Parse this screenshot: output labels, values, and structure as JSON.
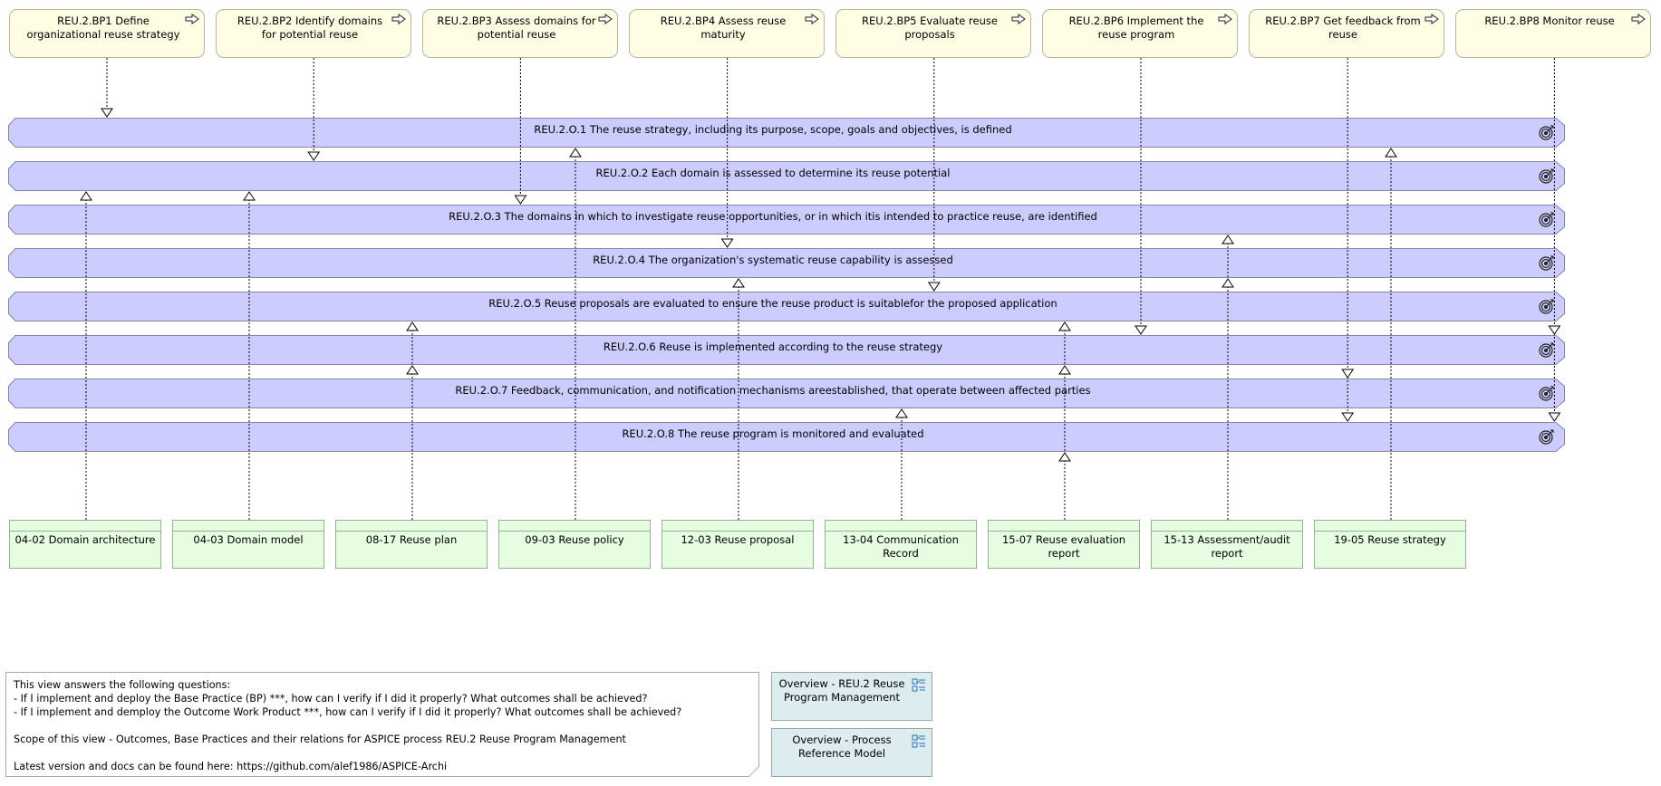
{
  "base_practices": [
    {
      "id": "BP1",
      "label": "REU.2.BP1 Define organizational reuse strategy"
    },
    {
      "id": "BP2",
      "label": "REU.2.BP2 Identify domains for potential reuse"
    },
    {
      "id": "BP3",
      "label": "REU.2.BP3 Assess domains for potential reuse"
    },
    {
      "id": "BP4",
      "label": "REU.2.BP4 Assess reuse maturity"
    },
    {
      "id": "BP5",
      "label": "REU.2.BP5 Evaluate reuse proposals"
    },
    {
      "id": "BP6",
      "label": "REU.2.BP6 Implement the reuse program"
    },
    {
      "id": "BP7",
      "label": "REU.2.BP7 Get feedback from reuse"
    },
    {
      "id": "BP8",
      "label": "REU.2.BP8 Monitor reuse"
    }
  ],
  "outcomes": [
    {
      "id": "O1",
      "label": "REU.2.O.1 The reuse strategy, including its purpose, scope, goals and objectives, is defined"
    },
    {
      "id": "O2",
      "label": "REU.2.O.2 Each domain is assessed to determine its reuse potential"
    },
    {
      "id": "O3",
      "label": "REU.2.O.3 The domains in which to investigate reuse opportunities, or in which itis intended to practice reuse, are identified"
    },
    {
      "id": "O4",
      "label": "REU.2.O.4 The organization's systematic reuse capability is assessed"
    },
    {
      "id": "O5",
      "label": "REU.2.O.5 Reuse proposals are evaluated to ensure the reuse product is suitablefor the proposed application"
    },
    {
      "id": "O6",
      "label": "REU.2.O.6 Reuse is implemented according to the reuse strategy"
    },
    {
      "id": "O7",
      "label": "REU.2.O.7 Feedback, communication, and notification mechanisms areestablished, that operate between affected parties"
    },
    {
      "id": "O8",
      "label": "REU.2.O.8 The reuse program is monitored and evaluated"
    }
  ],
  "work_products": [
    {
      "id": "WP0402",
      "label": "04-02 Domain architecture"
    },
    {
      "id": "WP0403",
      "label": "04-03 Domain model"
    },
    {
      "id": "WP0817",
      "label": "08-17 Reuse plan"
    },
    {
      "id": "WP0903",
      "label": "09-03 Reuse policy"
    },
    {
      "id": "WP1203",
      "label": "12-03 Reuse proposal"
    },
    {
      "id": "WP1304",
      "label": "13-04 Communication Record"
    },
    {
      "id": "WP1507",
      "label": "15-07 Reuse evaluation report"
    },
    {
      "id": "WP1513",
      "label": "15-13 Assessment/audit report"
    },
    {
      "id": "WP1905",
      "label": "19-05 Reuse strategy"
    }
  ],
  "bp_to_outcome": [
    [
      "BP1",
      "O1"
    ],
    [
      "BP2",
      "O2"
    ],
    [
      "BP3",
      "O3"
    ],
    [
      "BP4",
      "O4"
    ],
    [
      "BP5",
      "O5"
    ],
    [
      "BP6",
      "O6"
    ],
    [
      "BP7",
      "O7"
    ],
    [
      "BP7",
      "O8"
    ],
    [
      "BP8",
      "O6"
    ],
    [
      "BP8",
      "O8"
    ]
  ],
  "wp_to_outcome": [
    [
      "WP0402",
      "O2"
    ],
    [
      "WP0403",
      "O2"
    ],
    [
      "WP0817",
      "O5"
    ],
    [
      "WP0817",
      "O6"
    ],
    [
      "WP0903",
      "O1"
    ],
    [
      "WP1203",
      "O4"
    ],
    [
      "WP1304",
      "O7"
    ],
    [
      "WP1507",
      "O5"
    ],
    [
      "WP1507",
      "O6"
    ],
    [
      "WP1507",
      "O8"
    ],
    [
      "WP1513",
      "O3"
    ],
    [
      "WP1513",
      "O4"
    ],
    [
      "WP1905",
      "O1"
    ]
  ],
  "note": {
    "text": "This view answers the following questions:\n- If I implement and deploy the Base Practice (BP) ***, how can I verify if I did it properly? What outcomes shall be achieved?\n- If I implement and demploy the Outcome Work Product ***, how can I verify if I did it properly? What outcomes shall be achieved?\n\nScope of this view - Outcomes, Base Practices and their relations for ASPICE process REU.2 Reuse Program Management\n\nLatest version and docs can be found here: https://github.com/alef1986/ASPICE-Archi"
  },
  "view_references": [
    {
      "label": "Overview - REU.2 Reuse Program Management",
      "icon": "view-reference-icon"
    },
    {
      "label": "Overview - Process Reference Model",
      "icon": "view-reference-icon"
    }
  ],
  "icons": {
    "base_practice": "process-arrow-icon",
    "outcome": "target-goal-icon",
    "view_reference": "diagram-model-reference-icon"
  },
  "colors": {
    "base_practice_fill": "#fffde3",
    "outcome_fill": "#ccccff",
    "work_product_fill": "#e6fde2",
    "view_reference_fill": "#ddecee"
  }
}
